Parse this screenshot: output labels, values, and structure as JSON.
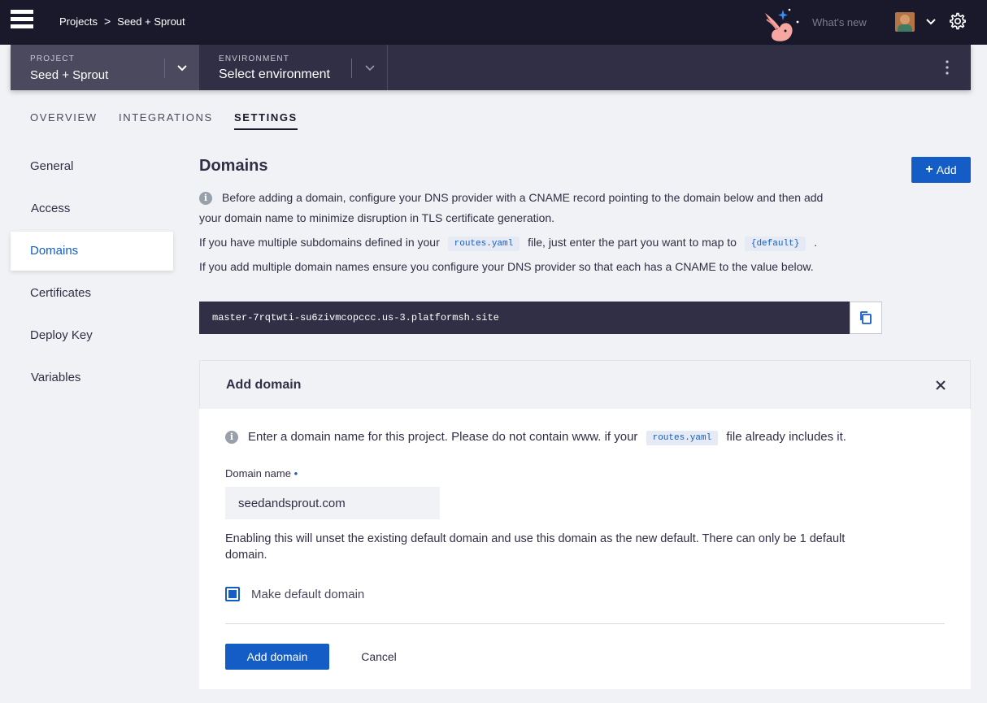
{
  "topbar": {
    "breadcrumb": [
      "Projects",
      "Seed + Sprout"
    ],
    "breadcrumb_separator": ">",
    "whats_new": "What's new",
    "icons": [
      "menu-icon",
      "rabbit-mascot-icon",
      "chevron-down-icon",
      "gear-icon"
    ]
  },
  "project_selector": {
    "label": "PROJECT",
    "value": "Seed + Sprout"
  },
  "environment_selector": {
    "label": "ENVIRONMENT",
    "value": "Select environment"
  },
  "tabs": [
    {
      "label": "OVERVIEW",
      "active": false
    },
    {
      "label": "INTEGRATIONS",
      "active": false
    },
    {
      "label": "SETTINGS",
      "active": true
    }
  ],
  "sidebar": {
    "items": [
      {
        "label": "General",
        "active": false
      },
      {
        "label": "Access",
        "active": false
      },
      {
        "label": "Domains",
        "active": true
      },
      {
        "label": "Certificates",
        "active": false
      },
      {
        "label": "Deploy Key",
        "active": false
      },
      {
        "label": "Variables",
        "active": false
      }
    ]
  },
  "main": {
    "title": "Domains",
    "add_button": "Add",
    "info_line1": "Before adding a domain, configure your DNS provider with a CNAME record pointing to the domain below and then add",
    "info_line2": "your domain name to minimize disruption in TLS certificate generation.",
    "subdomain_pre": "If you have multiple subdomains defined in your",
    "routes_chip": "routes.yaml",
    "subdomain_mid": "file, just enter the part you want to map to",
    "default_chip": "{default}",
    "subdomain_post": ".",
    "multi_domain": "If you add multiple domain names ensure you configure your DNS provider so that each has a CNAME to the value below.",
    "cname_value": "master-7rqtwti-su6zivmcopccc.us-3.platformsh.site"
  },
  "add_domain_panel": {
    "title": "Add domain",
    "info_pre": "Enter a domain name for this project. Please do not contain www. if your",
    "info_chip": "routes.yaml",
    "info_post": "file already includes it.",
    "field_label": "Domain name",
    "required_marker": "•",
    "field_value": "seedandsprout.com",
    "default_note_line1": "Enabling this will unset the existing default domain and use this domain as the new default. There can only be 1 default",
    "default_note_line2": "domain.",
    "checkbox_label": "Make default domain",
    "checkbox_checked": true,
    "submit_label": "Add domain",
    "cancel_label": "Cancel"
  },
  "colors": {
    "topbar": "#1a192b",
    "project_bar": "#302f45",
    "accent": "#145cc6",
    "background": "#f0f2f5"
  }
}
